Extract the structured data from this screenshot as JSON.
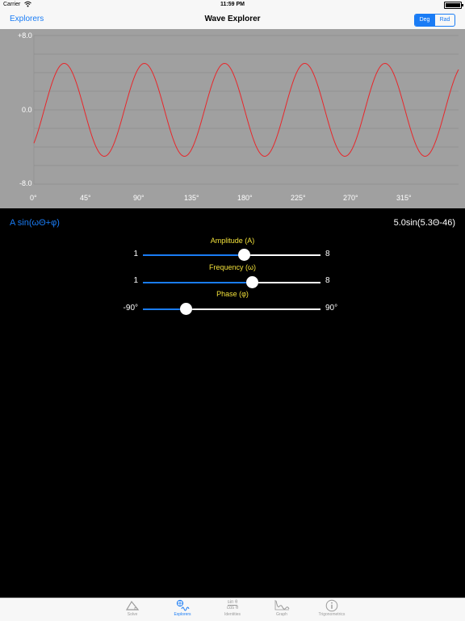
{
  "status_bar": {
    "carrier": "Carrier",
    "time": "11:59 PM"
  },
  "nav": {
    "back_label": "Explorers",
    "title": "Wave Explorer",
    "segments": [
      "Deg",
      "Rad"
    ],
    "active_segment": "Deg"
  },
  "graph": {
    "y_labels": [
      "+8.0",
      "0.0",
      "-8.0"
    ],
    "x_labels": [
      "0°",
      "45°",
      "90°",
      "135°",
      "180°",
      "225°",
      "270°",
      "315°"
    ]
  },
  "formula": {
    "general": "A sin(ωΘ+φ)",
    "current": "5.0sin(5.3Θ-46)"
  },
  "sliders": [
    {
      "title": "Amplitude (A)",
      "min_label": "1",
      "max_label": "8",
      "min": 1,
      "max": 8,
      "value": 5.0
    },
    {
      "title": "Frequency (ω)",
      "min_label": "1",
      "max_label": "8",
      "min": 1,
      "max": 8,
      "value": 5.3
    },
    {
      "title": "Phase (φ)",
      "min_label": "-90°",
      "max_label": "90°",
      "min": -90,
      "max": 90,
      "value": -46
    }
  ],
  "tabs": [
    {
      "label": "Solve",
      "icon": "triangle-icon"
    },
    {
      "label": "Explorers",
      "icon": "wave-explorer-icon"
    },
    {
      "label": "Identities",
      "icon": "sin-cos-fraction-icon",
      "icon_text": [
        "sin θ",
        "cos θ"
      ]
    },
    {
      "label": "Graph",
      "icon": "graph-icon"
    },
    {
      "label": "Trigonometrics",
      "icon": "info-icon"
    }
  ],
  "active_tab": "Explorers",
  "colors": {
    "accent": "#1a7cf5",
    "wave": "#e8262a",
    "graph_bg": "#a0a0a0",
    "slider_title": "#f2e13a"
  },
  "chart_data": {
    "type": "line",
    "function": "A*sin(ω*θ+φ)",
    "amplitude": 5.0,
    "frequency": 5.3,
    "phase_deg": -46,
    "ylim": [
      -8,
      8
    ],
    "xlim": [
      0,
      360
    ],
    "x_unit": "degrees",
    "xticks": [
      0,
      45,
      90,
      135,
      180,
      225,
      270,
      315
    ],
    "yticks": [
      8,
      0,
      -8
    ],
    "grid": true
  }
}
